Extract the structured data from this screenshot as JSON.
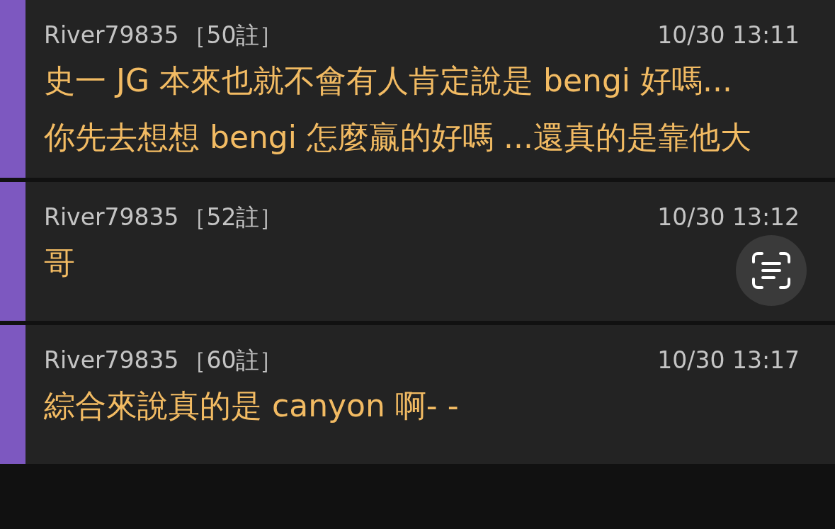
{
  "comments": [
    {
      "user": "River79835",
      "count": "［50註］",
      "time": "10/30 13:11",
      "paragraphs": [
        "史一 JG 本來也就不會有人肯定說是 bengi 好嗎...",
        "你先去想想 bengi 怎麼贏的好嗎 ...還真的是靠他大"
      ],
      "scan_button": false
    },
    {
      "user": "River79835",
      "count": "［52註］",
      "time": "10/30 13:12",
      "paragraphs": [
        "哥"
      ],
      "scan_button": true
    },
    {
      "user": "River79835",
      "count": "［60註］",
      "time": "10/30 13:17",
      "paragraphs": [
        "綜合來說真的是 canyon 啊- -"
      ],
      "scan_button": false
    }
  ]
}
